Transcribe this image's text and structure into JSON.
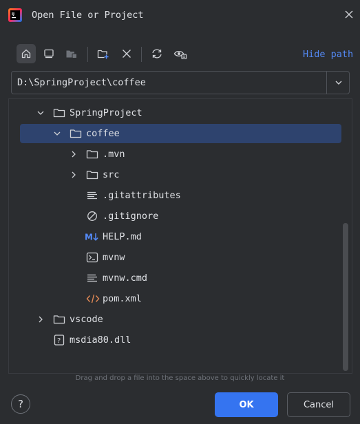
{
  "window": {
    "title": "Open File or Project",
    "app_icon": "intellij-logo-icon",
    "close_icon": "close-icon"
  },
  "toolbar": {
    "buttons": [
      {
        "icon": "home-icon",
        "active": true
      },
      {
        "icon": "desktop-icon"
      },
      {
        "icon": "project-folder-icon"
      },
      {
        "icon": "new-folder-icon"
      },
      {
        "icon": "delete-icon"
      },
      {
        "icon": "refresh-icon"
      },
      {
        "icon": "show-hidden-icon"
      }
    ],
    "hide_path_label": "Hide path"
  },
  "path": {
    "value": "D:\\SpringProject\\coffee",
    "dropdown_icon": "chevron-down-icon"
  },
  "tree": {
    "items": [
      {
        "label": "SpringProject",
        "type": "folder",
        "expanded": true
      },
      {
        "label": "coffee",
        "type": "folder",
        "expanded": true,
        "selected": true
      },
      {
        "label": ".mvn",
        "type": "folder",
        "expanded": false
      },
      {
        "label": "src",
        "type": "folder",
        "expanded": false
      },
      {
        "label": ".gitattributes",
        "type": "text-file"
      },
      {
        "label": ".gitignore",
        "type": "ignore-file"
      },
      {
        "label": "HELP.md",
        "type": "markdown-file"
      },
      {
        "label": "mvnw",
        "type": "shell-file"
      },
      {
        "label": "mvnw.cmd",
        "type": "text-file"
      },
      {
        "label": "pom.xml",
        "type": "xml-file"
      },
      {
        "label": "vscode",
        "type": "folder",
        "expanded": false
      },
      {
        "label": "msdia80.dll",
        "type": "unknown-file"
      }
    ]
  },
  "hint": "Drag and drop a file into the space above to quickly locate it",
  "footer": {
    "help_label": "?",
    "ok_label": "OK",
    "cancel_label": "Cancel"
  },
  "colors": {
    "background": "#2b2d30",
    "accent": "#3574f0",
    "selection": "#2e436e",
    "link": "#548af7",
    "xml_icon": "#e08855",
    "markdown_icon": "#548af7"
  }
}
